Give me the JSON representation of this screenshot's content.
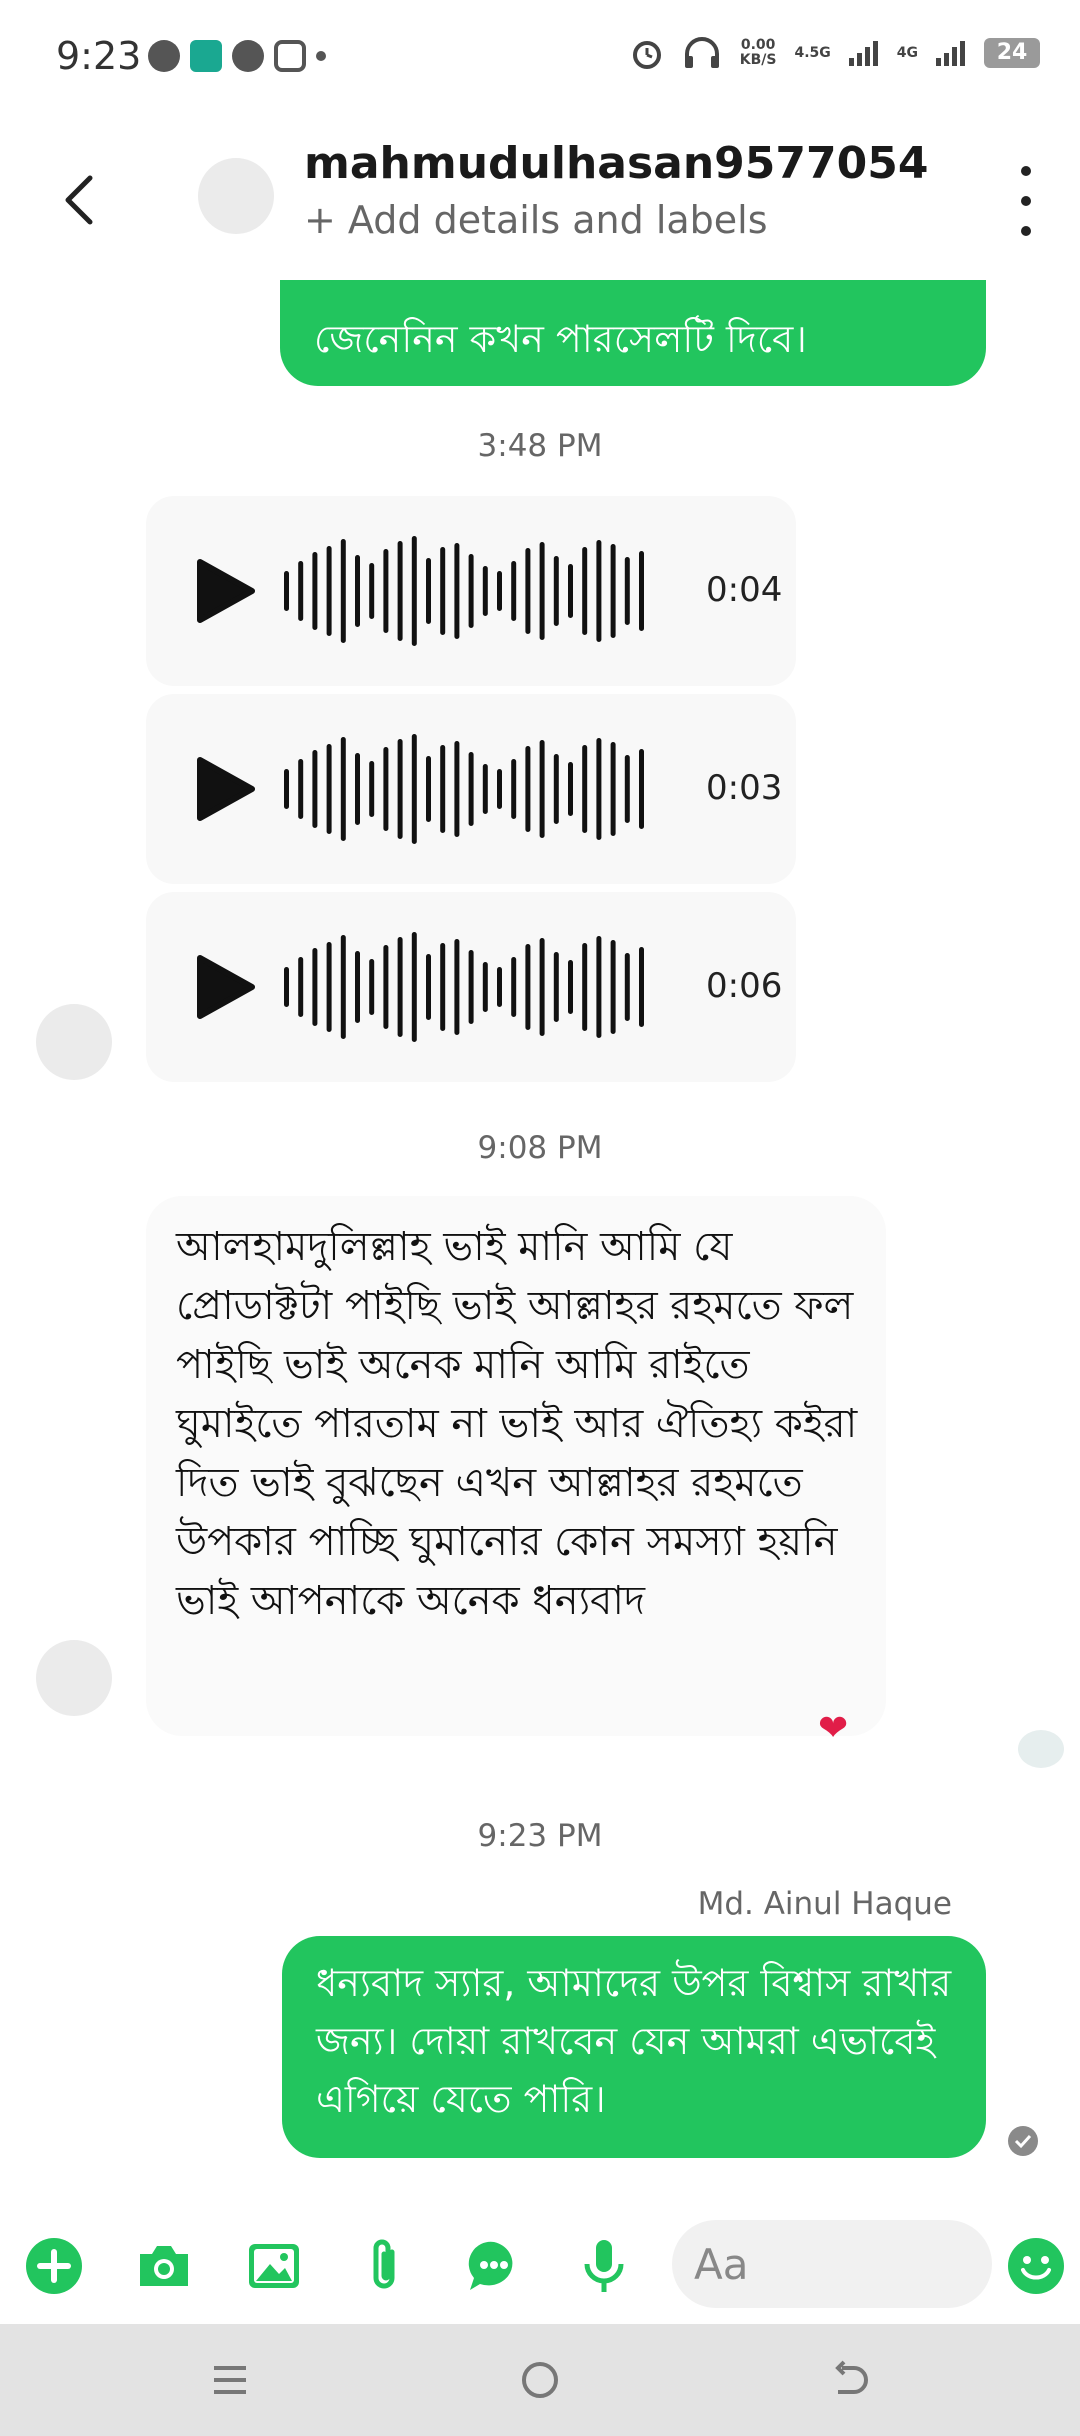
{
  "status_bar": {
    "time": "9:23",
    "speed": "0.00",
    "speed_unit": "KB/S",
    "net1": "4.5G",
    "net2": "4G",
    "battery": "24"
  },
  "header": {
    "contact_name": "mahmudulhasan9577054",
    "subtitle": "+ Add details and labels"
  },
  "messages": {
    "top_partial_bubble": "জেনেনিন কখন পারসেলটি দিবে।",
    "time_1": "3:48 PM",
    "audio": [
      {
        "duration": "0:04"
      },
      {
        "duration": "0:03"
      },
      {
        "duration": "0:06"
      }
    ],
    "time_2": "9:08 PM",
    "incoming_text": "আলহামদুলিল্লাহ ভাই মানি আমি যে প্রোডাক্টটা পাইছি ভাই আল্লাহর রহমতে ফল পাইছি ভাই অনেক মানি আমি রাইতে ঘুমাইতে পারতাম না ভাই আর ঐতিহ্য কইরা দিত ভাই বুঝছেন এখন আল্লাহর রহমতে উপকার পাচ্ছি ঘুমানোর কোন সমস্যা হয়নি ভাই আপনাকে অনেক ধন্যবাদ",
    "reaction": "❤",
    "time_3": "9:23 PM",
    "sender_name": "Md. Ainul Haque",
    "outgoing_text": "ধন্যবাদ স্যার, আমাদের উপর বিশ্বাস রাখার জন্য। দোয়া রাখবেন যেন আমরা এভাবেই এগিয়ে যেতে পারি।"
  },
  "composer": {
    "placeholder": "Aa",
    "icons": [
      "plus-icon",
      "camera-icon",
      "gallery-icon",
      "attachment-icon",
      "chat-icon",
      "microphone-icon",
      "emoji-icon"
    ]
  },
  "colors": {
    "accent_green": "#22c55e",
    "incoming_bg": "#fafafa"
  }
}
